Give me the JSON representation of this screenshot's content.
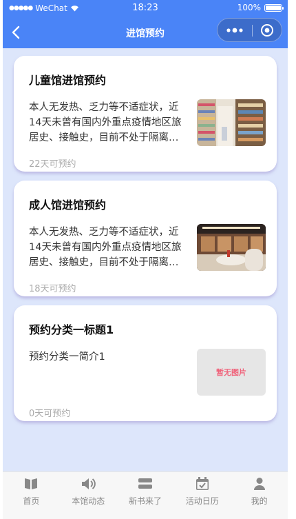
{
  "status_bar": {
    "carrier": "WeChat",
    "time": "18:23",
    "battery": "100%"
  },
  "navbar": {
    "title": "进馆预约"
  },
  "cards": [
    {
      "title": "儿童馆进馆预约",
      "desc_lines": [
        "本人无发热、乏力等不适症状，近",
        "14天未曾有国内外重点疫情地区旅",
        "居史、接触史，目前不处于隔离…"
      ],
      "days": "22天可预约",
      "image": "library-bookshelves-photo"
    },
    {
      "title": "成人馆进馆预约",
      "desc_lines": [
        "本人无发热、乏力等不适症状，近",
        "14天未曾有国内外重点疫情地区旅",
        "居史、接触史，目前不处于隔离…"
      ],
      "days": "18天可预约",
      "image": "library-hall-photo"
    },
    {
      "title": "预约分类一标题1",
      "desc_lines": [
        "预约分类一简介1"
      ],
      "days": "0天可预约",
      "no_image_text": "暂无图片"
    }
  ],
  "tabbar": [
    {
      "label": "首页",
      "icon": "book-open-icon"
    },
    {
      "label": "本馆动态",
      "icon": "speaker-icon"
    },
    {
      "label": "新书来了",
      "icon": "books-stack-icon"
    },
    {
      "label": "活动日历",
      "icon": "calendar-check-icon"
    },
    {
      "label": "我的",
      "icon": "user-icon"
    }
  ],
  "colors": {
    "header": "#4a84f7",
    "background": "#dde6fb",
    "no_image_text": "#f0627a"
  }
}
